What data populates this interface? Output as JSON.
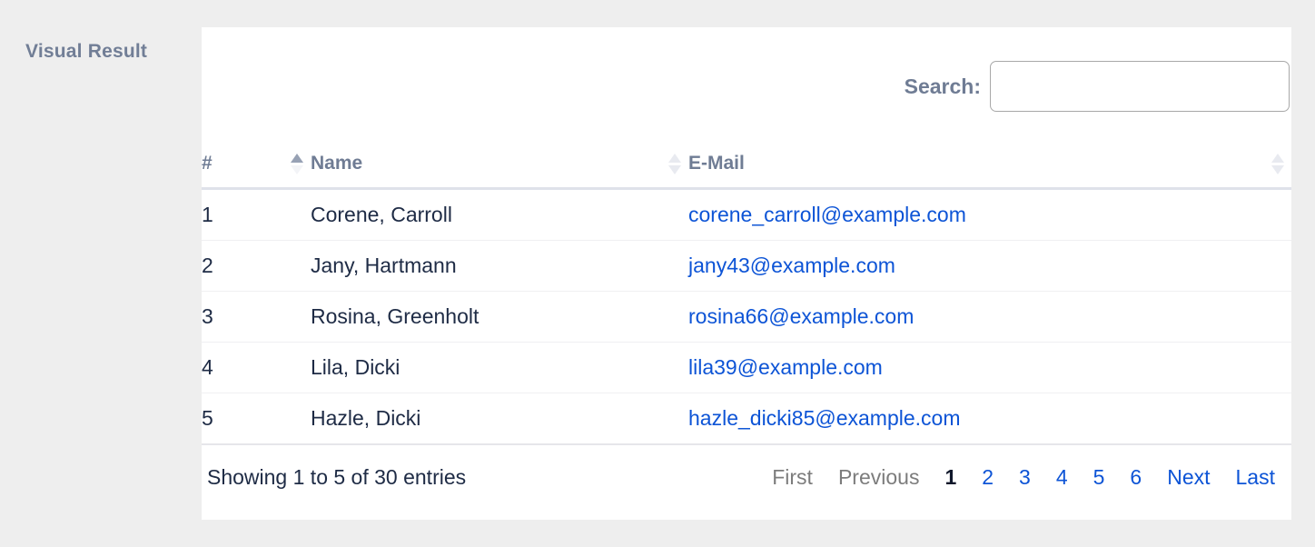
{
  "gutter": {
    "label": "Visual Result"
  },
  "search": {
    "label": "Search:",
    "value": "",
    "placeholder": ""
  },
  "table": {
    "columns": [
      {
        "key": "num",
        "label": "#",
        "sort": "asc"
      },
      {
        "key": "name",
        "label": "Name",
        "sort": "none"
      },
      {
        "key": "email",
        "label": "E-Mail",
        "sort": "none"
      }
    ],
    "rows": [
      {
        "num": "1",
        "name": "Corene, Carroll",
        "email": "corene_carroll@example.com"
      },
      {
        "num": "2",
        "name": "Jany, Hartmann",
        "email": "jany43@example.com"
      },
      {
        "num": "3",
        "name": "Rosina, Greenholt",
        "email": "rosina66@example.com"
      },
      {
        "num": "4",
        "name": "Lila, Dicki",
        "email": "lila39@example.com"
      },
      {
        "num": "5",
        "name": "Hazle, Dicki",
        "email": "hazle_dicki85@example.com"
      }
    ]
  },
  "footer": {
    "info": "Showing 1 to 5 of 30 entries",
    "pagination": [
      {
        "label": "First",
        "state": "disabled"
      },
      {
        "label": "Previous",
        "state": "disabled"
      },
      {
        "label": "1",
        "state": "current"
      },
      {
        "label": "2",
        "state": "link"
      },
      {
        "label": "3",
        "state": "link"
      },
      {
        "label": "4",
        "state": "link"
      },
      {
        "label": "5",
        "state": "link"
      },
      {
        "label": "6",
        "state": "link"
      },
      {
        "label": "Next",
        "state": "link"
      },
      {
        "label": "Last",
        "state": "link"
      }
    ]
  },
  "colors": {
    "page_background": "#eeeeee",
    "card_background": "#ffffff",
    "header_text": "#6f7c94",
    "body_text": "#1e2b45",
    "link": "#0d54d6",
    "disabled": "#7c7c7c",
    "header_rule": "#dfe2ea"
  }
}
